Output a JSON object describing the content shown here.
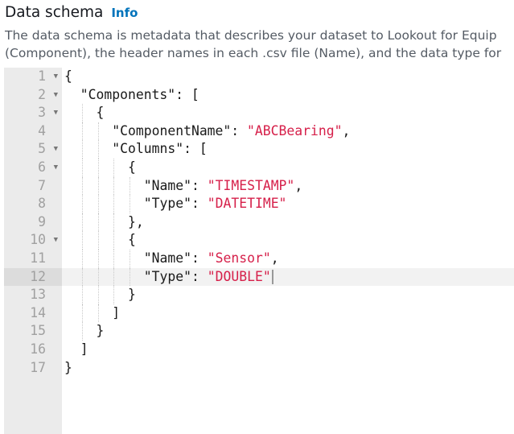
{
  "header": {
    "title": "Data schema",
    "info_link": "Info"
  },
  "description": [
    "The data schema is metadata that describes your dataset to Lookout for Equip",
    "(Component), the header names in each .csv file (Name), and the data type for"
  ],
  "editor": {
    "active_line": 12,
    "lines": [
      {
        "n": "1",
        "fold": true,
        "indent": 0,
        "t": [
          [
            "p",
            "{"
          ]
        ]
      },
      {
        "n": "2",
        "fold": true,
        "indent": 1,
        "t": [
          [
            "p",
            "\"Components\": ["
          ]
        ]
      },
      {
        "n": "3",
        "fold": true,
        "indent": 2,
        "t": [
          [
            "p",
            "{"
          ]
        ]
      },
      {
        "n": "4",
        "fold": false,
        "indent": 3,
        "t": [
          [
            "p",
            "\"ComponentName\": "
          ],
          [
            "s",
            "\"ABCBearing\""
          ],
          [
            "p",
            ","
          ]
        ]
      },
      {
        "n": "5",
        "fold": true,
        "indent": 3,
        "t": [
          [
            "p",
            "\"Columns\": ["
          ]
        ]
      },
      {
        "n": "6",
        "fold": true,
        "indent": 4,
        "t": [
          [
            "p",
            "{"
          ]
        ]
      },
      {
        "n": "7",
        "fold": false,
        "indent": 5,
        "t": [
          [
            "p",
            "\"Name\": "
          ],
          [
            "s",
            "\"TIMESTAMP\""
          ],
          [
            "p",
            ","
          ]
        ]
      },
      {
        "n": "8",
        "fold": false,
        "indent": 5,
        "t": [
          [
            "p",
            "\"Type\": "
          ],
          [
            "s",
            "\"DATETIME\""
          ]
        ]
      },
      {
        "n": "9",
        "fold": false,
        "indent": 4,
        "t": [
          [
            "p",
            "},"
          ]
        ]
      },
      {
        "n": "10",
        "fold": true,
        "indent": 4,
        "t": [
          [
            "p",
            "{"
          ]
        ]
      },
      {
        "n": "11",
        "fold": false,
        "indent": 5,
        "t": [
          [
            "p",
            "\"Name\": "
          ],
          [
            "s",
            "\"Sensor\""
          ],
          [
            "p",
            ","
          ]
        ]
      },
      {
        "n": "12",
        "fold": false,
        "indent": 5,
        "t": [
          [
            "p",
            "\"Type\": "
          ],
          [
            "s",
            "\"DOUBLE\""
          ]
        ]
      },
      {
        "n": "13",
        "fold": false,
        "indent": 4,
        "t": [
          [
            "p",
            "}"
          ]
        ]
      },
      {
        "n": "14",
        "fold": false,
        "indent": 3,
        "t": [
          [
            "p",
            "]"
          ]
        ]
      },
      {
        "n": "15",
        "fold": false,
        "indent": 2,
        "t": [
          [
            "p",
            "}"
          ]
        ]
      },
      {
        "n": "16",
        "fold": false,
        "indent": 1,
        "t": [
          [
            "p",
            "]"
          ]
        ]
      },
      {
        "n": "17",
        "fold": false,
        "indent": 0,
        "t": [
          [
            "p",
            "}"
          ]
        ]
      }
    ]
  }
}
